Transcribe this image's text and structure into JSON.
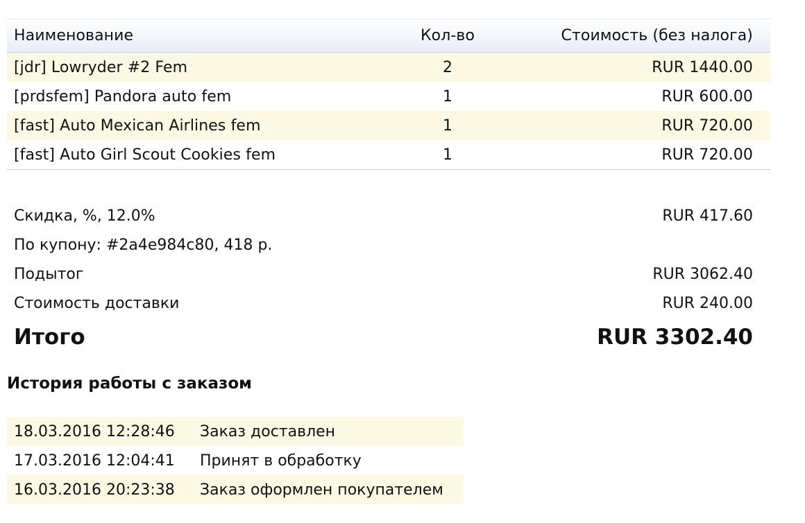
{
  "order": {
    "columns": {
      "name": "Наименование",
      "qty": "Кол-во",
      "cost": "Стоимость (без налога)"
    },
    "items": [
      {
        "name": "[jdr] Lowryder #2 Fem",
        "qty": "2",
        "cost": "RUR 1440.00"
      },
      {
        "name": "[prdsfem] Pandora auto fem",
        "qty": "1",
        "cost": "RUR 600.00"
      },
      {
        "name": "[fast] Auto Mexican Airlines fem",
        "qty": "1",
        "cost": "RUR 720.00"
      },
      {
        "name": "[fast] Auto Girl Scout Cookies fem",
        "qty": "1",
        "cost": "RUR 720.00"
      }
    ]
  },
  "summary": {
    "discount_label": "Скидка, %, 12.0%",
    "discount_value": "RUR 417.60",
    "coupon_label": "По купону: #2a4e984c80, 418 р.",
    "subtotal_label": "Подытог",
    "subtotal_value": "RUR 3062.40",
    "shipping_label": "Стоимость доставки",
    "shipping_value": "RUR 240.00",
    "total_label": "Итого",
    "total_value": "RUR 3302.40"
  },
  "history": {
    "title": "История работы с заказом",
    "entries": [
      {
        "date": "18.03.2016 12:28:46",
        "status": "Заказ доставлен"
      },
      {
        "date": "17.03.2016 12:04:41",
        "status": "Принят в обработку"
      },
      {
        "date": "16.03.2016 20:23:38",
        "status": "Заказ оформлен покупателем"
      }
    ]
  },
  "colors": {
    "row_highlight": "#fbf8e3",
    "header_gradient_end": "#e9edf5",
    "divider": "#c8c8c8"
  }
}
